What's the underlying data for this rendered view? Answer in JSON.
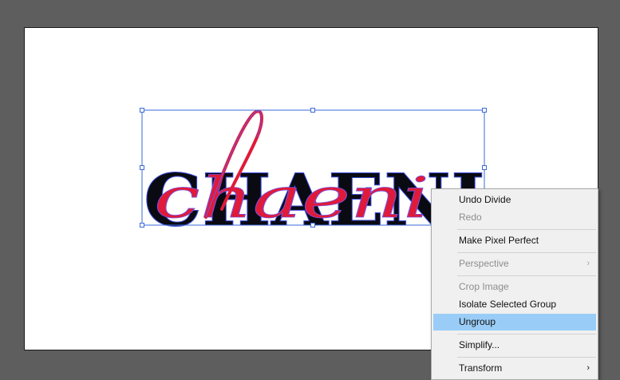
{
  "artwork": {
    "main_text": "CHAENI",
    "script_text": "chaeni",
    "colors": {
      "artboard": "#ffffff",
      "pasteboard": "#5e5e5e",
      "main_fill": "#0a0a12",
      "script_fill": "#e01a38",
      "selection": "#3a6ad8"
    }
  },
  "context_menu": {
    "undo": "Undo Divide",
    "redo": "Redo",
    "make_pixel_perfect": "Make Pixel Perfect",
    "perspective": "Perspective",
    "crop_image": "Crop Image",
    "isolate_group": "Isolate Selected Group",
    "ungroup": "Ungroup",
    "simplify": "Simplify...",
    "transform": "Transform",
    "submenu_arrow": "›"
  }
}
